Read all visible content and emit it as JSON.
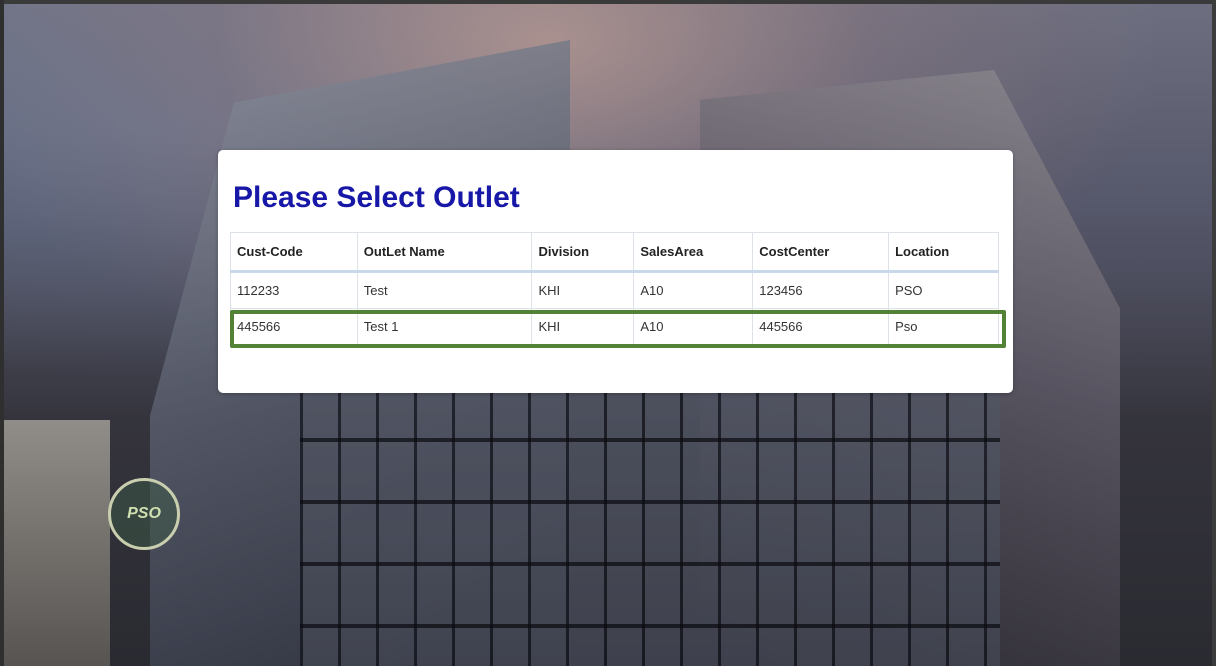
{
  "page": {
    "title": "Please Select Outlet"
  },
  "table": {
    "headers": [
      "Cust-Code",
      "OutLet Name",
      "Division",
      "SalesArea",
      "CostCenter",
      "Location"
    ],
    "rows": [
      [
        "112233",
        "Test",
        "KHI",
        "A10",
        "123456",
        "PSO"
      ],
      [
        "445566",
        "Test 1",
        "KHI",
        "A10",
        "445566",
        "Pso"
      ]
    ],
    "highlighted_row_index": 1,
    "highlight_color": "#538135"
  },
  "background": {
    "logo_text": "PSO"
  },
  "colors": {
    "title": "#1717a8",
    "card": "#ffffff"
  }
}
